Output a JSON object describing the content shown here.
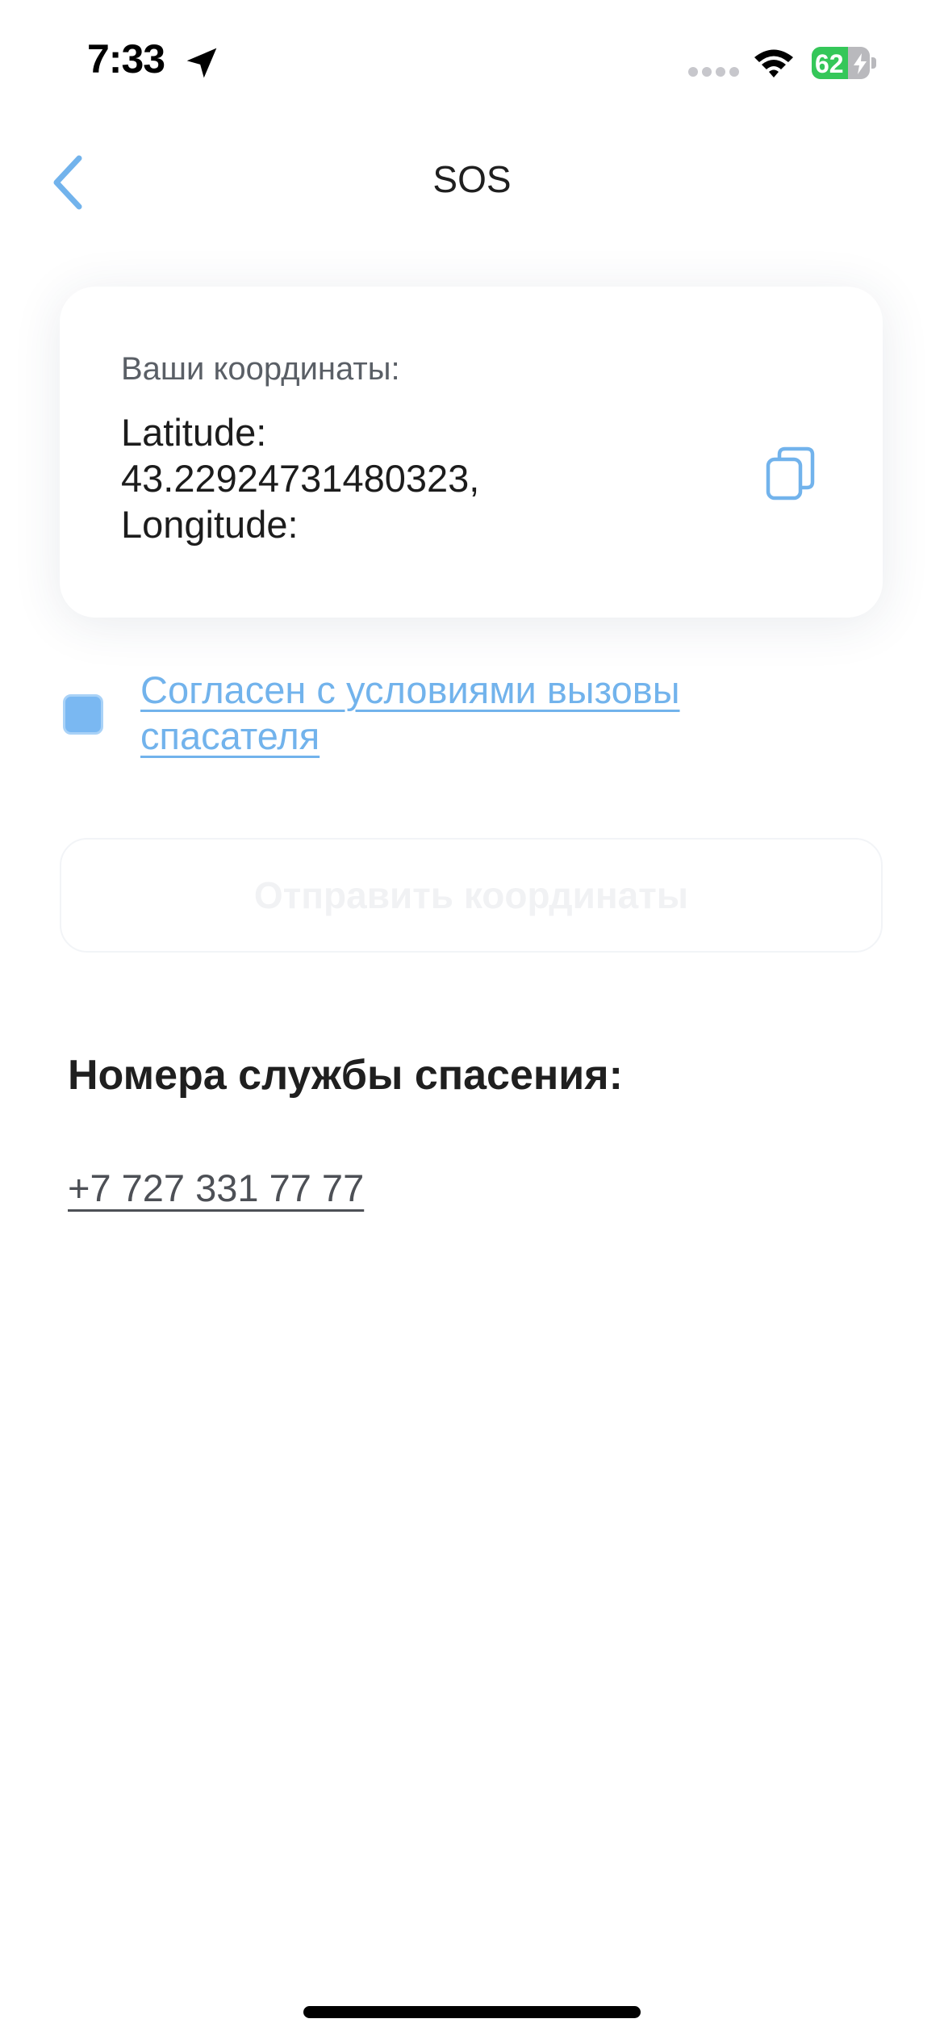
{
  "status_bar": {
    "time": "7:33",
    "battery_level": "62",
    "battery_fraction": 0.62,
    "battery_color": "#35c759",
    "icons": [
      "location-arrow-icon",
      "signal-dots-icon",
      "wifi-icon",
      "battery-icon",
      "charging-bolt-icon"
    ]
  },
  "nav": {
    "title": "SOS",
    "back_icon": "chevron-left-icon",
    "accent_color": "#72b3ec"
  },
  "coordinates_card": {
    "label": "Ваши координаты:",
    "line1": "Latitude:",
    "line2": "43.22924731480323,",
    "line3": "Longitude:",
    "copy_icon": "copy-icon"
  },
  "agreement": {
    "checked": true,
    "link_text": "Согласен с условиями вызовы спасателя"
  },
  "send_button": {
    "label": "Отправить координаты",
    "disabled": true
  },
  "rescue": {
    "heading": "Номера службы спасения:",
    "phone": "+7 727 331 77 77"
  }
}
